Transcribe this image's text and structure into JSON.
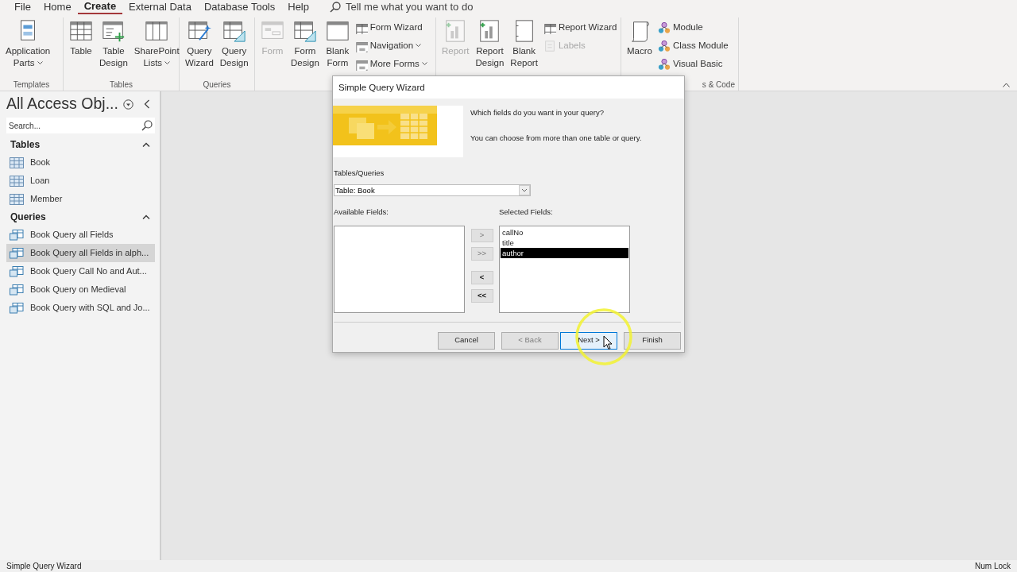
{
  "ribbon_tabs": [
    {
      "label": "File",
      "selected": false
    },
    {
      "label": "Home",
      "selected": false
    },
    {
      "label": "Create",
      "selected": true
    },
    {
      "label": "External Data",
      "selected": false
    },
    {
      "label": "Database Tools",
      "selected": false
    },
    {
      "label": "Help",
      "selected": false
    }
  ],
  "tell_me": {
    "placeholder": "Tell me what you want to do"
  },
  "ribbon_groups": [
    {
      "label": "Templates",
      "commands": [
        {
          "kind": "large",
          "lines": [
            "Application",
            "Parts"
          ],
          "dropdown": true,
          "disabled": false
        }
      ]
    },
    {
      "label": "Tables",
      "commands": [
        {
          "kind": "large",
          "lines": [
            "Table"
          ],
          "dropdown": false,
          "disabled": false
        },
        {
          "kind": "large",
          "lines": [
            "Table",
            "Design"
          ],
          "dropdown": false,
          "disabled": false
        },
        {
          "kind": "large",
          "lines": [
            "SharePoint",
            "Lists"
          ],
          "dropdown": true,
          "disabled": false
        }
      ]
    },
    {
      "label": "Queries",
      "commands": [
        {
          "kind": "large",
          "lines": [
            "Query",
            "Wizard"
          ],
          "dropdown": false,
          "disabled": false
        },
        {
          "kind": "large",
          "lines": [
            "Query",
            "Design"
          ],
          "dropdown": false,
          "disabled": false
        }
      ]
    },
    {
      "commands": [
        {
          "kind": "large",
          "lines": [
            "Form"
          ],
          "dropdown": false,
          "disabled": true
        },
        {
          "kind": "large",
          "lines": [
            "Form",
            "Design"
          ],
          "dropdown": false,
          "disabled": false
        },
        {
          "kind": "large",
          "lines": [
            "Blank",
            "Form"
          ],
          "dropdown": false,
          "disabled": false
        },
        {
          "kind": "small",
          "label": "Form Wizard",
          "dropdown": false,
          "disabled": false
        },
        {
          "kind": "small",
          "label": "Navigation",
          "dropdown": true,
          "disabled": false
        },
        {
          "kind": "small",
          "label": "More Forms",
          "dropdown": true,
          "disabled": false
        }
      ]
    },
    {
      "commands": [
        {
          "kind": "large",
          "lines": [
            "Report"
          ],
          "dropdown": false,
          "disabled": true
        },
        {
          "kind": "large",
          "lines": [
            "Report",
            "Design"
          ],
          "dropdown": false,
          "disabled": false
        },
        {
          "kind": "large",
          "lines": [
            "Blank",
            "Report"
          ],
          "dropdown": false,
          "disabled": false
        },
        {
          "kind": "small",
          "label": "Report Wizard",
          "dropdown": false,
          "disabled": false
        },
        {
          "kind": "small",
          "label": "Labels",
          "dropdown": false,
          "disabled": true
        }
      ]
    },
    {
      "label": "s & Code",
      "commands": [
        {
          "kind": "large",
          "lines": [
            "Macro"
          ],
          "dropdown": false,
          "disabled": false
        },
        {
          "kind": "small",
          "label": "Module",
          "dropdown": false,
          "disabled": false
        },
        {
          "kind": "small",
          "label": "Class Module",
          "dropdown": false,
          "disabled": false
        },
        {
          "kind": "small",
          "label": "Visual Basic",
          "dropdown": false,
          "disabled": false
        }
      ]
    }
  ],
  "nav_pane": {
    "title": "All Access Obj...",
    "search": {
      "placeholder": "Search..."
    },
    "groups": [
      {
        "label": "Tables",
        "expanded": true,
        "items": [
          {
            "kind": "table",
            "label": "Book",
            "selected": false
          },
          {
            "kind": "table",
            "label": "Loan",
            "selected": false
          },
          {
            "kind": "table",
            "label": "Member",
            "selected": false
          }
        ]
      },
      {
        "label": "Queries",
        "expanded": true,
        "items": [
          {
            "kind": "query",
            "label": "Book Query all Fields",
            "selected": false
          },
          {
            "kind": "query",
            "label": "Book Query all Fields in alph...",
            "selected": true
          },
          {
            "kind": "query",
            "label": "Book Query Call No and Aut...",
            "selected": false
          },
          {
            "kind": "query",
            "label": "Book Query on Medieval",
            "selected": false
          },
          {
            "kind": "query",
            "label": "Book Query with SQL and Jo...",
            "selected": false
          }
        ]
      }
    ]
  },
  "dialog": {
    "title": "Simple Query Wizard",
    "question": "Which fields do you want in your query?",
    "hint": "You can choose from more than one table or query.",
    "source_label": "Tables/Queries",
    "source": {
      "value": "Table: Book"
    },
    "available_label": "Available Fields:",
    "selected_label": "Selected Fields:",
    "selected_fields": [
      {
        "label": "callNo",
        "selected": false
      },
      {
        "label": "title",
        "selected": false
      },
      {
        "label": "author",
        "selected": true
      }
    ],
    "move_buttons": [
      {
        "label": ">",
        "disabled": true
      },
      {
        "label": ">>",
        "disabled": true
      },
      {
        "label": "<",
        "disabled": false
      },
      {
        "label": "<<",
        "disabled": false
      }
    ],
    "buttons": [
      {
        "label": "Cancel",
        "disabled": false,
        "focused": false
      },
      {
        "label": "< Back",
        "disabled": true,
        "focused": false
      },
      {
        "label": "Next >",
        "disabled": false,
        "focused": true
      },
      {
        "label": "Finish",
        "disabled": false,
        "focused": false
      }
    ]
  },
  "status_bar": {
    "left": "Simple Query Wizard",
    "right": "Num Lock"
  }
}
